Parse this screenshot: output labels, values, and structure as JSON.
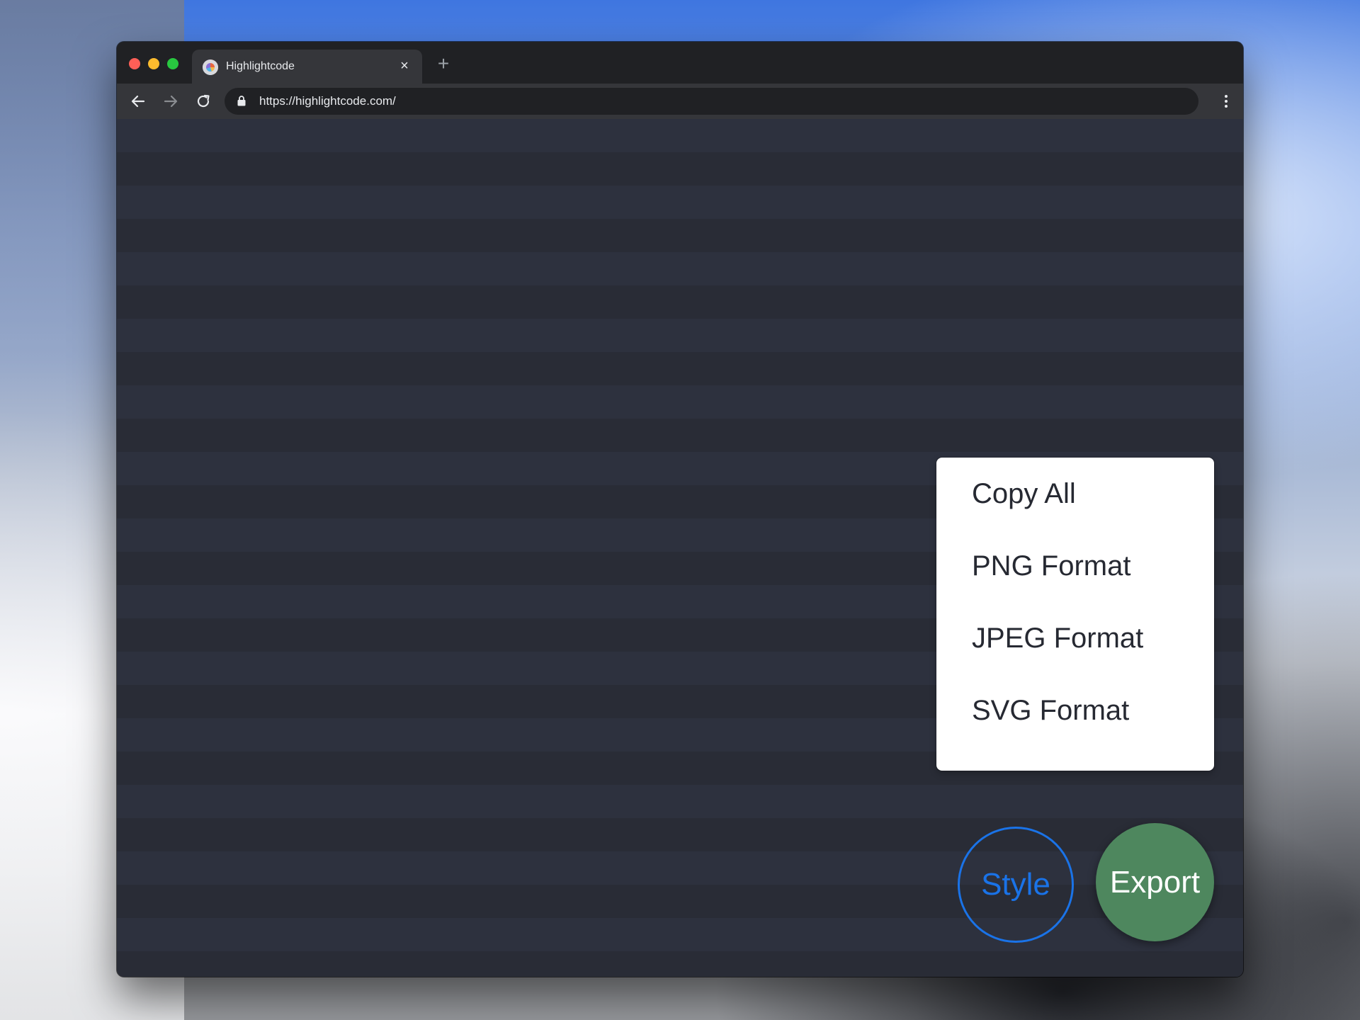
{
  "browser": {
    "tab": {
      "title": "Highlightcode",
      "close_icon": "×"
    },
    "new_tab_icon": "+",
    "url": "https://highlightcode.com/",
    "icons": {
      "back": "arrow-left-icon",
      "forward": "arrow-right-icon",
      "reload": "reload-icon",
      "lock": "lock-icon",
      "menu": "more-vertical-icon"
    }
  },
  "export_menu": {
    "items": [
      {
        "label": "Copy All"
      },
      {
        "label": "PNG Format"
      },
      {
        "label": "JPEG Format"
      },
      {
        "label": "SVG Format"
      }
    ]
  },
  "buttons": {
    "style_label": "Style",
    "export_label": "Export"
  },
  "colors": {
    "style_accent": "#1a73e8",
    "export_bg": "#4e875e",
    "content_stripe_a": "#2d313e",
    "content_stripe_b": "#292c36"
  }
}
